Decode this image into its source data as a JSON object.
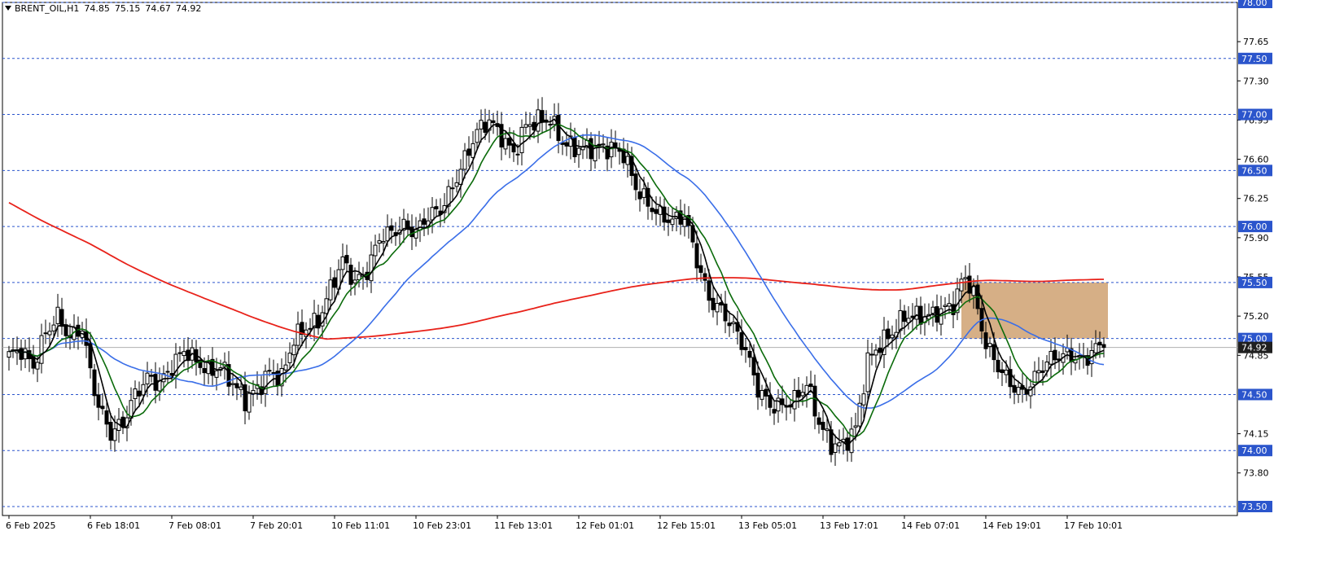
{
  "header": {
    "symbol": "BRENT_OIL,H1",
    "open": "74.85",
    "high": "75.15",
    "low": "74.67",
    "close": "74.92"
  },
  "colors": {
    "bull": "#ffffff",
    "bear": "#000000",
    "ma_fast": "#000000",
    "ma_mid": "#0b6b0b",
    "ma_slow": "#3a6ee8",
    "ma_long": "#e8221a",
    "levels": "#2b55cc",
    "zone": "#d2a679",
    "price_tag": "#1f1f1f"
  },
  "chart_data": {
    "type": "candlestick",
    "symbol": "BRENT_OIL",
    "timeframe": "H1",
    "ylim": [
      73.42,
      78.0
    ],
    "y_ticks": [
      "77.65",
      "77.30",
      "76.95",
      "76.60",
      "76.25",
      "75.90",
      "75.55",
      "75.20",
      "74.85",
      "74.15",
      "73.80"
    ],
    "x_ticks": [
      {
        "i": 0,
        "label": "6 Feb 2025"
      },
      {
        "i": 20,
        "label": "6 Feb 18:01"
      },
      {
        "i": 40,
        "label": "7 Feb 08:01"
      },
      {
        "i": 60,
        "label": "7 Feb 20:01"
      },
      {
        "i": 80,
        "label": "10 Feb 11:01"
      },
      {
        "i": 100,
        "label": "10 Feb 23:01"
      },
      {
        "i": 120,
        "label": "11 Feb 13:01"
      },
      {
        "i": 140,
        "label": "12 Feb 01:01"
      },
      {
        "i": 160,
        "label": "12 Feb 15:01"
      },
      {
        "i": 180,
        "label": "13 Feb 05:01"
      },
      {
        "i": 200,
        "label": "13 Feb 17:01"
      },
      {
        "i": 220,
        "label": "14 Feb 07:01"
      },
      {
        "i": 240,
        "label": "14 Feb 19:01"
      },
      {
        "i": 260,
        "label": "17 Feb 10:01"
      }
    ],
    "levels": [
      {
        "value": 78.0,
        "label": "78.00"
      },
      {
        "value": 77.5,
        "label": "77.50"
      },
      {
        "value": 77.0,
        "label": "77.00"
      },
      {
        "value": 76.5,
        "label": "76.50"
      },
      {
        "value": 76.0,
        "label": "76.00"
      },
      {
        "value": 75.5,
        "label": "75.50"
      },
      {
        "value": 75.0,
        "label": "75.00"
      },
      {
        "value": 74.5,
        "label": "74.50"
      },
      {
        "value": 74.0,
        "label": "74.00"
      },
      {
        "value": 73.5,
        "label": "73.50"
      }
    ],
    "current_price": {
      "value": 74.92,
      "label": "74.92"
    },
    "zone": {
      "from_i": 234,
      "to_i": 270,
      "low": 75.0,
      "high": 75.5
    },
    "anchors": [
      [
        0,
        74.85
      ],
      [
        3,
        74.9
      ],
      [
        6,
        74.75
      ],
      [
        9,
        75.05
      ],
      [
        12,
        75.2
      ],
      [
        15,
        75.0
      ],
      [
        18,
        75.1
      ],
      [
        20,
        74.7
      ],
      [
        22,
        74.4
      ],
      [
        25,
        74.15
      ],
      [
        28,
        74.25
      ],
      [
        31,
        74.5
      ],
      [
        34,
        74.65
      ],
      [
        37,
        74.6
      ],
      [
        40,
        74.75
      ],
      [
        43,
        74.9
      ],
      [
        46,
        74.8
      ],
      [
        49,
        74.7
      ],
      [
        52,
        74.75
      ],
      [
        55,
        74.6
      ],
      [
        58,
        74.45
      ],
      [
        61,
        74.55
      ],
      [
        64,
        74.7
      ],
      [
        67,
        74.65
      ],
      [
        70,
        75.0
      ],
      [
        73,
        75.1
      ],
      [
        76,
        75.15
      ],
      [
        79,
        75.45
      ],
      [
        82,
        75.7
      ],
      [
        85,
        75.5
      ],
      [
        88,
        75.6
      ],
      [
        91,
        75.9
      ],
      [
        94,
        75.95
      ],
      [
        97,
        76.0
      ],
      [
        100,
        75.95
      ],
      [
        103,
        76.1
      ],
      [
        106,
        76.15
      ],
      [
        109,
        76.35
      ],
      [
        112,
        76.6
      ],
      [
        115,
        76.85
      ],
      [
        118,
        76.95
      ],
      [
        121,
        76.8
      ],
      [
        124,
        76.65
      ],
      [
        127,
        76.9
      ],
      [
        130,
        76.95
      ],
      [
        133,
        76.95
      ],
      [
        136,
        76.75
      ],
      [
        139,
        76.7
      ],
      [
        142,
        76.7
      ],
      [
        145,
        76.7
      ],
      [
        148,
        76.7
      ],
      [
        151,
        76.65
      ],
      [
        154,
        76.35
      ],
      [
        157,
        76.2
      ],
      [
        160,
        76.1
      ],
      [
        163,
        76.05
      ],
      [
        166,
        76.1
      ],
      [
        169,
        75.7
      ],
      [
        172,
        75.35
      ],
      [
        175,
        75.25
      ],
      [
        178,
        75.1
      ],
      [
        181,
        74.9
      ],
      [
        184,
        74.55
      ],
      [
        187,
        74.4
      ],
      [
        190,
        74.4
      ],
      [
        193,
        74.45
      ],
      [
        196,
        74.6
      ],
      [
        199,
        74.25
      ],
      [
        202,
        74.05
      ],
      [
        205,
        74.05
      ],
      [
        208,
        74.2
      ],
      [
        211,
        74.8
      ],
      [
        214,
        74.95
      ],
      [
        217,
        75.05
      ],
      [
        220,
        75.2
      ],
      [
        223,
        75.2
      ],
      [
        226,
        75.2
      ],
      [
        229,
        75.25
      ],
      [
        232,
        75.3
      ],
      [
        234,
        75.5
      ],
      [
        235,
        75.55
      ],
      [
        237,
        75.4
      ],
      [
        240,
        74.95
      ],
      [
        243,
        74.75
      ],
      [
        246,
        74.6
      ],
      [
        249,
        74.5
      ],
      [
        252,
        74.65
      ],
      [
        255,
        74.8
      ],
      [
        258,
        74.85
      ],
      [
        261,
        74.85
      ],
      [
        264,
        74.8
      ],
      [
        267,
        74.92
      ],
      [
        269,
        74.92
      ]
    ]
  }
}
